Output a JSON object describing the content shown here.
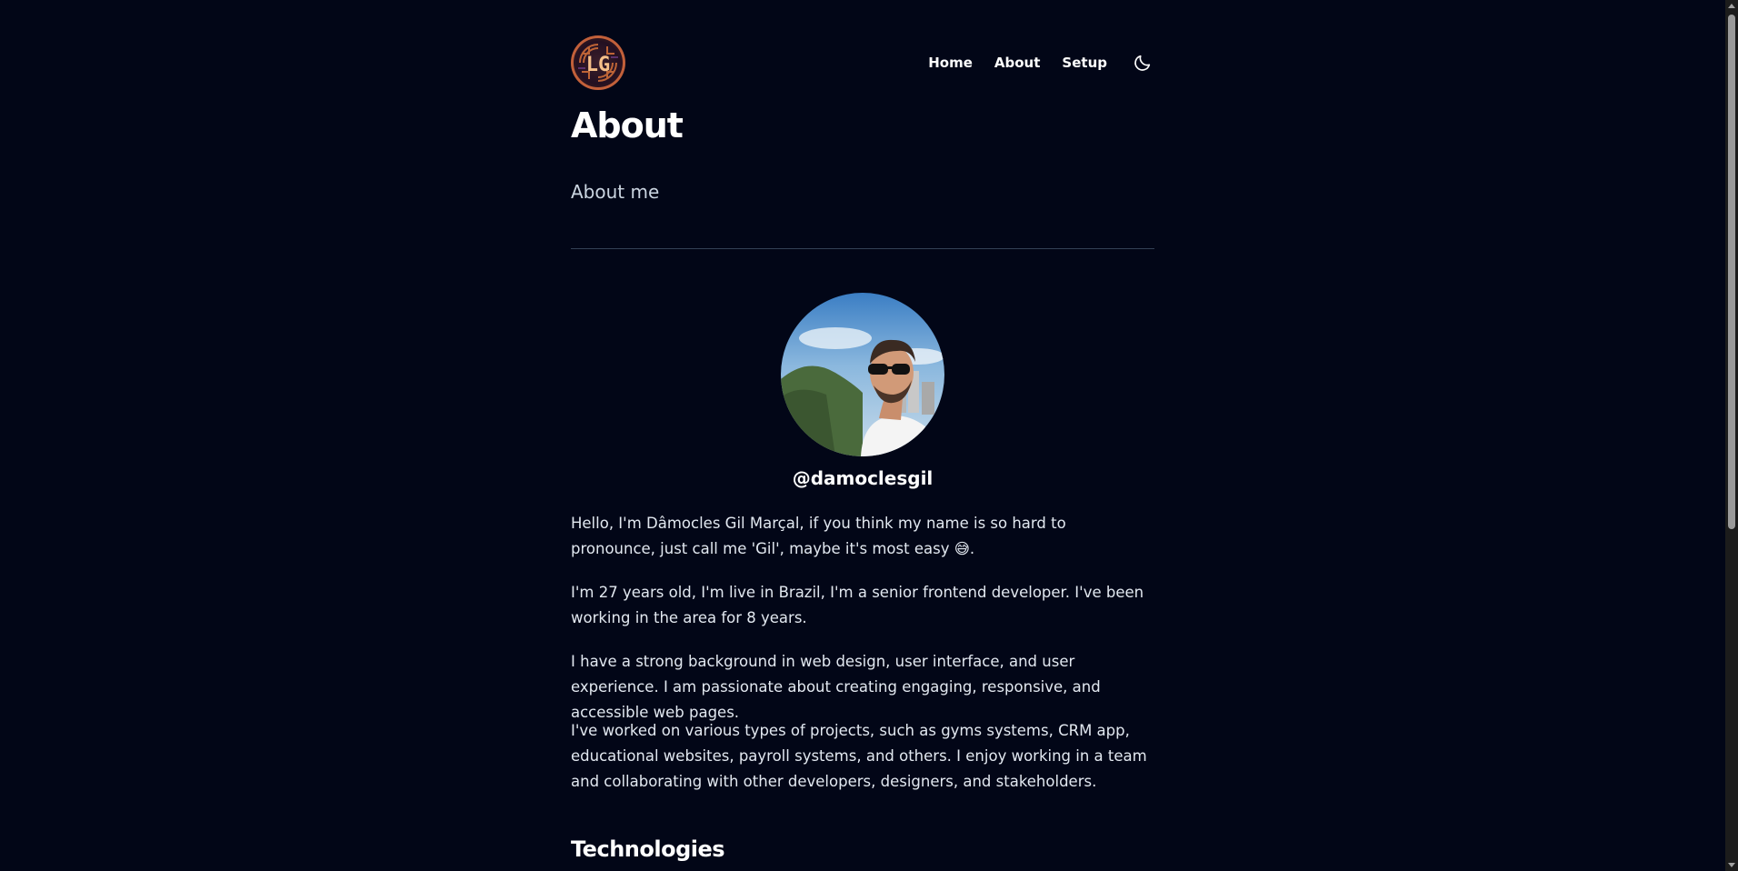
{
  "header": {
    "logo_text": "LG",
    "nav": [
      {
        "label": "Home"
      },
      {
        "label": "About"
      },
      {
        "label": "Setup"
      }
    ],
    "theme_toggle_icon": "moon-icon"
  },
  "main": {
    "title": "About",
    "subtitle": "About me",
    "handle": "@damoclesgil",
    "paragraphs": [
      "Hello, I'm Dâmocles Gil Marçal, if you think my name is so hard to pronounce, just call me 'Gil', maybe it's most easy 😅.",
      "I'm 27 years old, I'm live in Brazil, I'm a senior frontend developer. I've been working in the area for 8 years.",
      "I have a strong background in web design, user interface, and user experience. I am passionate about creating engaging, responsive, and accessible web pages.",
      "I've worked on various types of projects, such as gyms systems, CRM app, educational websites, payroll systems, and others. I enjoy working in a team and collaborating with other developers, designers, and stakeholders."
    ],
    "section_title": "Technologies"
  },
  "colors": {
    "background": "#020617",
    "text": "#e2e8f0",
    "heading": "#ffffff",
    "divider": "#334155",
    "logo_accent": "#f0a33a"
  }
}
